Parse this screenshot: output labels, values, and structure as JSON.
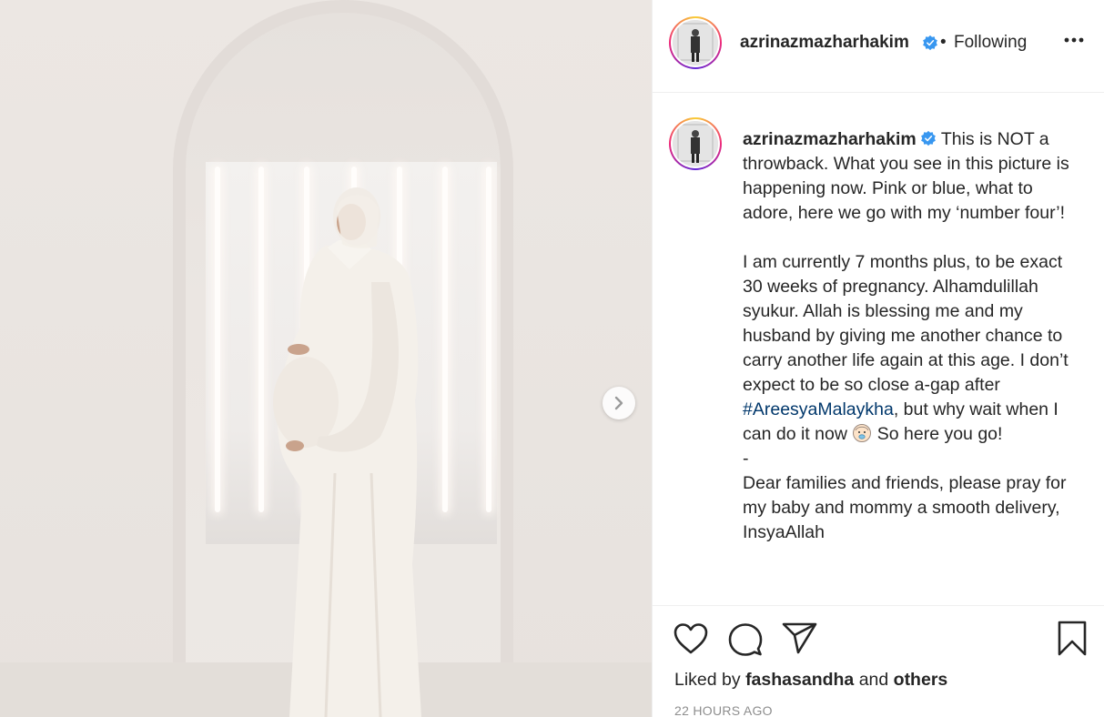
{
  "post": {
    "username": "azrinazmazharhakim",
    "follow_state": "Following",
    "separator": "•",
    "caption": {
      "paragraph_1": "This is NOT a throwback. What you see in this picture is happening now. Pink or blue, what to adore, here we go with my ‘number four’!",
      "paragraph_2_before_tag": "I am currently 7 months plus, to be exact 30 weeks of pregnancy. Alhamdulillah syukur. Allah is blessing me and my husband by giving me another chance to carry another life again at this age. I don’t expect to be so close a-gap after ",
      "hashtag": "#AreesyaMalaykha",
      "paragraph_2_after_tag": ", but why wait when I can do it now ",
      "paragraph_2_end": " So here you go!",
      "dash": "-",
      "paragraph_3": "Dear families and friends, please pray for my baby and mommy a smooth delivery, InsyaAllah"
    },
    "likes": {
      "prefix": "Liked by ",
      "user": "fashasandha",
      "middle": " and ",
      "others": "others"
    },
    "timestamp": "22 HOURS AGO"
  },
  "icons": {
    "verified": "verified-badge-icon",
    "more": "more-options-icon",
    "next": "chevron-right-icon",
    "like": "heart-icon",
    "comment": "comment-icon",
    "share": "paper-plane-icon",
    "save": "bookmark-icon",
    "emoji": "baby-face-emoji"
  },
  "colors": {
    "verified_blue": "#3897f0",
    "hashtag": "#00376b",
    "muted_text": "#8e8e8e",
    "divider": "#efefef"
  }
}
